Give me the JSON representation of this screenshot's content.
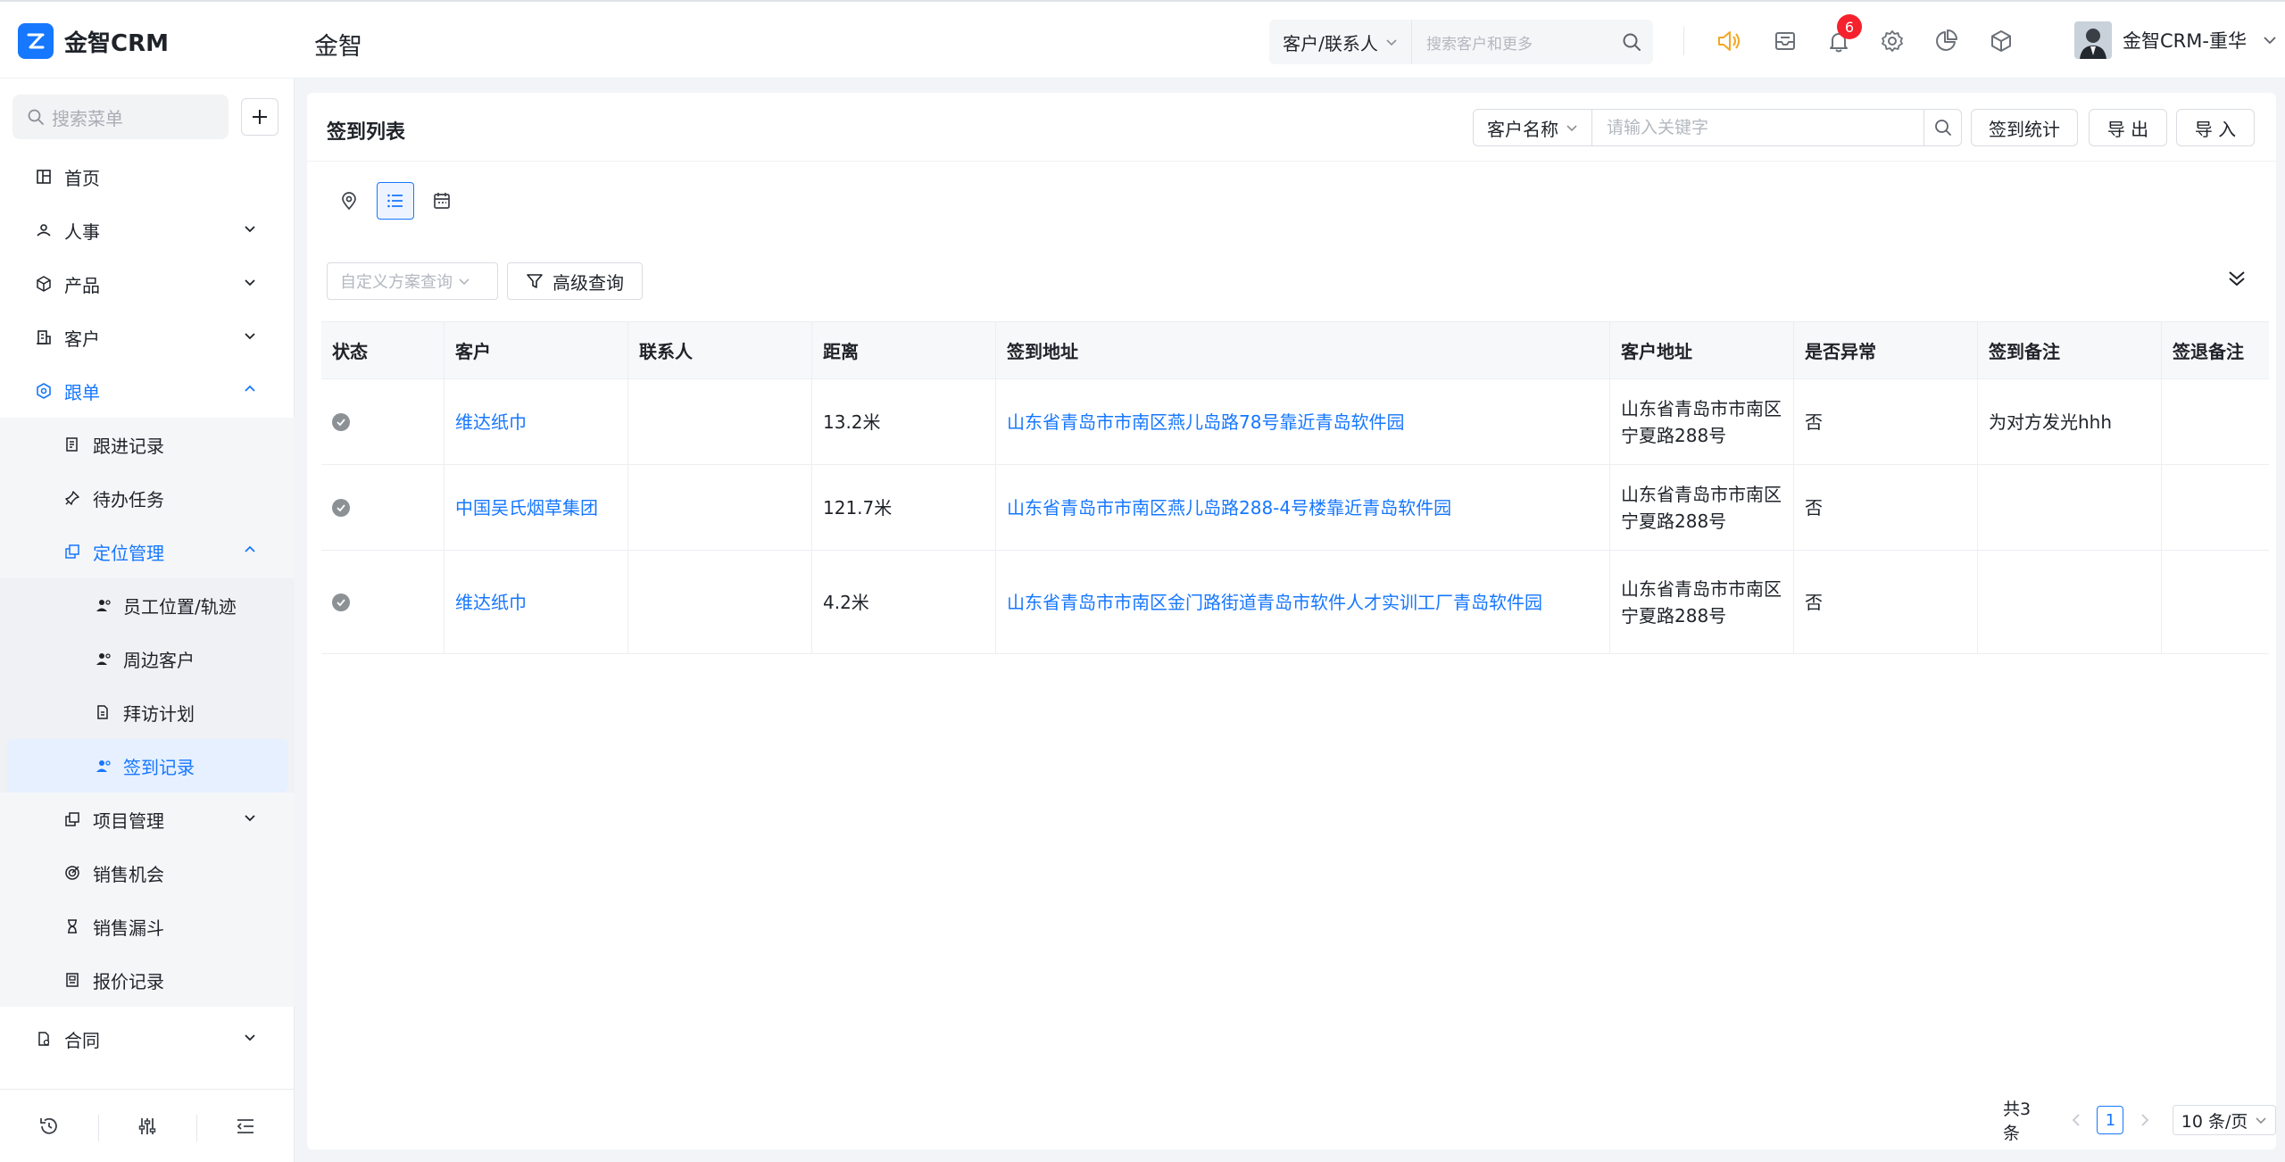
{
  "header": {
    "logo_text": "金智CRM",
    "app_title": "金智",
    "search_type": "客户/联系人",
    "search_placeholder": "搜索客户和更多",
    "notification_count": "6",
    "user_name": "金智CRM-重华",
    "accent": "#1677ff",
    "icons": [
      "speaker-icon",
      "inbox-icon",
      "bell-icon",
      "gear-icon",
      "pie-chart-icon",
      "cube-icon"
    ]
  },
  "sidebar": {
    "search_placeholder": "搜索菜单",
    "items": {
      "home": "首页",
      "hr": "人事",
      "product": "产品",
      "customer": "客户",
      "followup": "跟单",
      "followup_record": "跟进记录",
      "todo": "待办任务",
      "location": "定位管理",
      "staff_track": "员工位置/轨迹",
      "nearby": "周边客户",
      "visit_plan": "拜访计划",
      "checkin_record": "签到记录",
      "project": "项目管理",
      "opportunity": "销售机会",
      "funnel": "销售漏斗",
      "quote": "报价记录",
      "contract": "合同"
    }
  },
  "panel": {
    "title": "签到列表",
    "filter_field": "客户名称",
    "keyword_placeholder": "请输入关键字",
    "stats_button": "签到统计",
    "export_button": "导 出",
    "import_button": "导 入",
    "scheme_placeholder": "自定义方案查询",
    "advanced_button": "高级查询"
  },
  "table": {
    "columns": [
      "状态",
      "客户",
      "联系人",
      "距离",
      "签到地址",
      "客户地址",
      "是否异常",
      "签到备注",
      "签退备注"
    ],
    "rows": [
      {
        "customer": "维达纸巾",
        "contact": "",
        "distance": "13.2米",
        "checkin_address": "山东省青岛市市南区燕儿岛路78号靠近青岛软件园",
        "customer_address": "山东省青岛市市南区宁夏路288号",
        "abnormal": "否",
        "checkin_note": "为对方发光hhh",
        "checkout_note": ""
      },
      {
        "customer": "中国吴氏烟草集团",
        "contact": "",
        "distance": "121.7米",
        "checkin_address": "山东省青岛市市南区燕儿岛路288-4号楼靠近青岛软件园",
        "customer_address": "山东省青岛市市南区宁夏路288号",
        "abnormal": "否",
        "checkin_note": "",
        "checkout_note": ""
      },
      {
        "customer": "维达纸巾",
        "contact": "",
        "distance": "4.2米",
        "checkin_address": "山东省青岛市市南区金门路街道青岛市软件人才实训工厂青岛软件园",
        "customer_address": "山东省青岛市市南区宁夏路288号",
        "abnormal": "否",
        "checkin_note": "",
        "checkout_note": ""
      }
    ]
  },
  "pagination": {
    "total": "共3条",
    "current_page": "1",
    "page_size": "10 条/页"
  }
}
